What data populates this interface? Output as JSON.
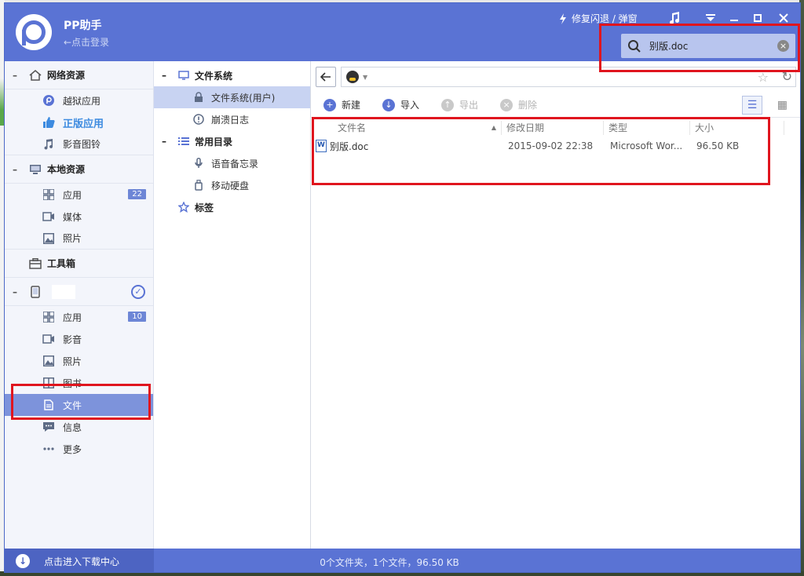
{
  "app": {
    "title": "PP助手",
    "login_hint": "←点击登录"
  },
  "titlebar": {
    "fix_label": "修复闪退 / 弹窗"
  },
  "search": {
    "value": "别版.doc"
  },
  "sidebar": {
    "network": {
      "label": "网络资源",
      "items": [
        {
          "label": "越狱应用"
        },
        {
          "label": "正版应用"
        },
        {
          "label": "影音图铃"
        }
      ]
    },
    "local": {
      "label": "本地资源",
      "items": [
        {
          "label": "应用",
          "badge": "22"
        },
        {
          "label": "媒体"
        },
        {
          "label": "照片"
        }
      ]
    },
    "toolbox": {
      "label": "工具箱"
    },
    "device": {
      "items": [
        {
          "label": "应用",
          "badge": "10"
        },
        {
          "label": "影音"
        },
        {
          "label": "照片"
        },
        {
          "label": "图书"
        },
        {
          "label": "文件"
        },
        {
          "label": "信息"
        },
        {
          "label": "更多"
        }
      ]
    }
  },
  "tree": {
    "filesystem": {
      "label": "文件系统",
      "children": [
        {
          "label": "文件系统(用户)"
        },
        {
          "label": "崩溃日志"
        }
      ]
    },
    "common": {
      "label": "常用目录",
      "children": [
        {
          "label": "语音备忘录"
        },
        {
          "label": "移动硬盘"
        }
      ]
    },
    "tags": {
      "label": "标签"
    }
  },
  "toolbar": {
    "new": "新建",
    "import": "导入",
    "export": "导出",
    "delete": "删除"
  },
  "table": {
    "headers": {
      "name": "文件名",
      "date": "修改日期",
      "type": "类型",
      "size": "大小"
    },
    "rows": [
      {
        "name": "别版.doc",
        "date": "2015-09-02 22:38",
        "type": "Microsoft Wor...",
        "size": "96.50 KB"
      }
    ]
  },
  "status": {
    "download_center": "点击进入下载中心",
    "summary": "0个文件夹，1个文件，96.50 KB"
  },
  "colors": {
    "accent": "#5a73d4",
    "highlight": "#e0151e",
    "active_item": "#7d93db"
  },
  "icons": {
    "fix": "lightning-icon",
    "music": "music-note-icon",
    "menu": "dropdown-menu-icon",
    "search": "search-icon"
  }
}
